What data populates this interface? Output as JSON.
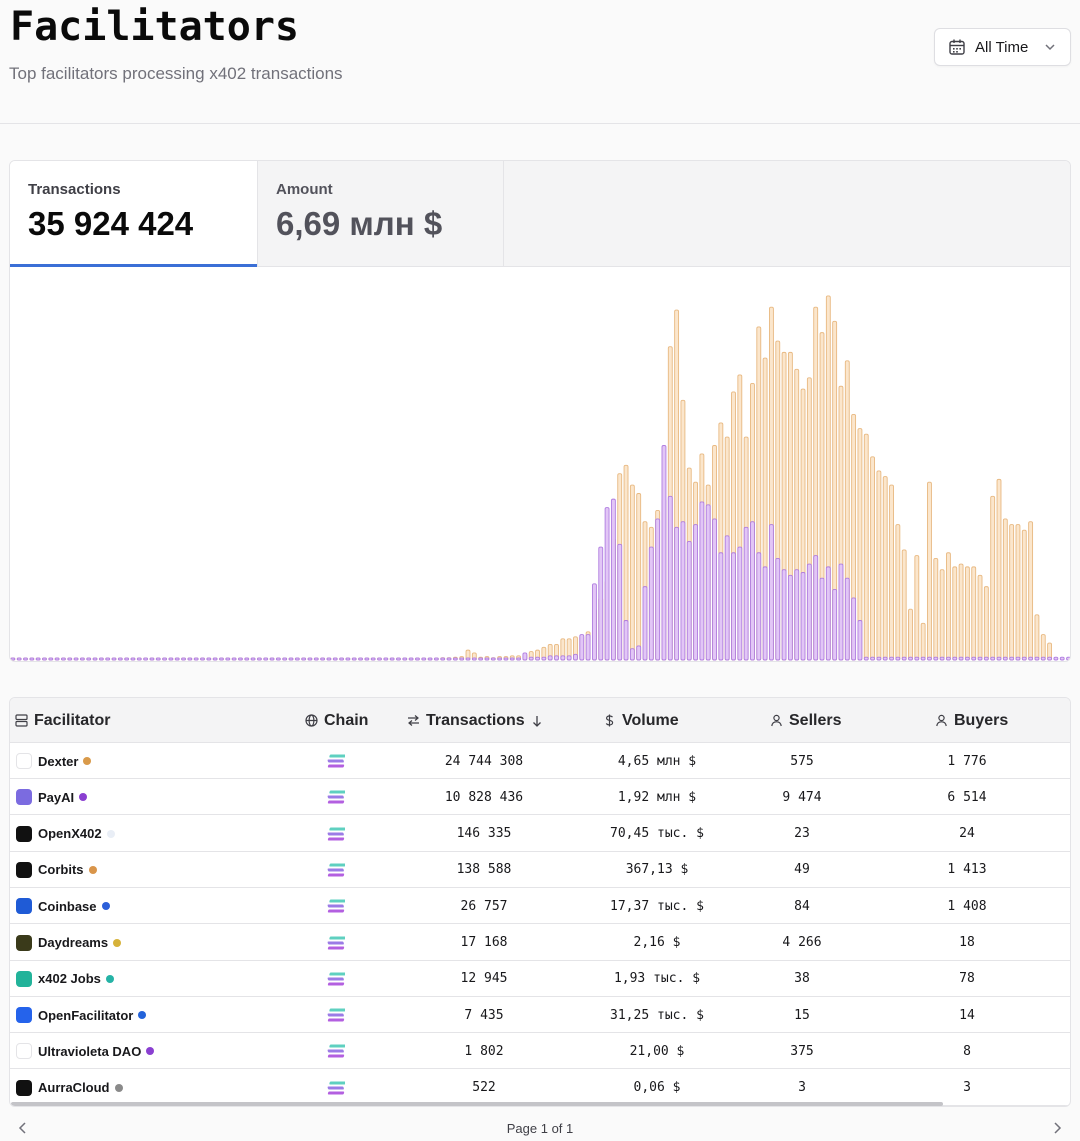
{
  "header": {
    "title": "Facilitators",
    "subtitle": "Top facilitators processing x402 transactions",
    "range_label": "All Time"
  },
  "stats": {
    "transactions_label": "Transactions",
    "transactions_value": "35 924 424",
    "amount_label": "Amount",
    "amount_value": "6,69 млн $"
  },
  "colors": {
    "accent": "#3b6fd6",
    "bar_primary_fill": "#fbe6cc",
    "bar_primary_stroke": "#e8b982",
    "bar_secondary_fill": "#e2c6f6",
    "bar_secondary_stroke": "#b07ee0"
  },
  "chart_data": {
    "type": "bar",
    "stacked": false,
    "series": [
      {
        "values": [
          0.02,
          0.02,
          0.02,
          0.02,
          0.02,
          0.02,
          0.02,
          0.02,
          0.02,
          0.02,
          0.02,
          0.02,
          0.02,
          0.02,
          0.02,
          0.02,
          0.02,
          0.02,
          0.02,
          0.02,
          0.02,
          0.02,
          0.02,
          0.02,
          0.02,
          0.02,
          0.02,
          0.02,
          0.02,
          0.02,
          0.02,
          0.02,
          0.02,
          0.02,
          0.02,
          0.02,
          0.02,
          0.02,
          0.02,
          0.02,
          0.03,
          0.03,
          0.03,
          0.03,
          0.03,
          0.03,
          0.03,
          0.03,
          0.04,
          0.04,
          0.04,
          0.04,
          0.04,
          0.04,
          0.04,
          0.04,
          0.04,
          0.04,
          0.05,
          0.05,
          0.05,
          0.05,
          0.05,
          0.06,
          0.06,
          0.06,
          0.06,
          0.07,
          0.08,
          0.08,
          0.1,
          0.12,
          0.35,
          0.25,
          0.1,
          0.12,
          0.08,
          0.12,
          0.12,
          0.15,
          0.15,
          0.2,
          0.3,
          0.35,
          0.45,
          0.55,
          0.55,
          0.75,
          0.75,
          0.82,
          0.85,
          1.0,
          1.8,
          2.2,
          2.8,
          4.3,
          6.6,
          6.9,
          6.2,
          5.9,
          4.9,
          4.7,
          5.3,
          5.7,
          11.1,
          12.4,
          9.2,
          6.8,
          6.3,
          7.3,
          6.2,
          7.6,
          8.4,
          7.9,
          9.5,
          10.1,
          7.9,
          9.8,
          11.8,
          10.7,
          12.5,
          11.3,
          10.9,
          10.9,
          10.3,
          9.6,
          10.0,
          12.5,
          11.6,
          12.9,
          12.0,
          9.7,
          10.6,
          8.7,
          8.2,
          8.0,
          7.2,
          6.7,
          6.5,
          6.2,
          4.8,
          3.9,
          1.8,
          3.7,
          1.3,
          6.3,
          3.6,
          3.2,
          3.8,
          3.3,
          3.4,
          3.3,
          3.3,
          3.0,
          2.6,
          5.8,
          6.4,
          5.0,
          4.8,
          4.8,
          4.6,
          4.9,
          1.6,
          0.9,
          0.6
        ]
      },
      {
        "values": [
          0.02,
          0.02,
          0.02,
          0.02,
          0.02,
          0.02,
          0.02,
          0.02,
          0.02,
          0.02,
          0.02,
          0.02,
          0.02,
          0.02,
          0.02,
          0.02,
          0.02,
          0.02,
          0.02,
          0.02,
          0.02,
          0.02,
          0.02,
          0.02,
          0.02,
          0.02,
          0.02,
          0.02,
          0.02,
          0.02,
          0.02,
          0.02,
          0.02,
          0.02,
          0.02,
          0.02,
          0.02,
          0.02,
          0.02,
          0.02,
          0.02,
          0.02,
          0.02,
          0.02,
          0.02,
          0.02,
          0.02,
          0.02,
          0.03,
          0.03,
          0.03,
          0.03,
          0.03,
          0.03,
          0.04,
          0.04,
          0.04,
          0.04,
          0.04,
          0.04,
          0.04,
          0.04,
          0.04,
          0.04,
          0.04,
          0.04,
          0.04,
          0.04,
          0.05,
          0.05,
          0.05,
          0.05,
          0.06,
          0.06,
          0.06,
          0.06,
          0.06,
          0.06,
          0.06,
          0.06,
          0.06,
          0.25,
          0.1,
          0.1,
          0.1,
          0.15,
          0.15,
          0.15,
          0.15,
          0.2,
          0.9,
          0.9,
          2.7,
          4.0,
          5.4,
          5.7,
          4.1,
          1.4,
          0.4,
          0.5,
          2.6,
          4.0,
          5.0,
          7.6,
          5.8,
          4.7,
          4.9,
          4.2,
          4.8,
          5.6,
          5.5,
          5.0,
          3.8,
          4.4,
          3.8,
          4.0,
          4.7,
          4.9,
          3.8,
          3.3,
          4.8,
          3.6,
          3.2,
          3.0,
          3.2,
          3.1,
          3.4,
          3.7,
          2.9,
          3.3,
          2.5,
          3.4,
          2.9,
          2.2,
          1.4,
          0.1,
          0.1,
          0.1,
          0.1,
          0.1,
          0.1,
          0.1,
          0.1,
          0.1,
          0.1,
          0.1,
          0.1,
          0.1,
          0.1,
          0.1,
          0.1,
          0.1,
          0.1,
          0.1,
          0.1,
          0.1,
          0.1,
          0.1,
          0.1,
          0.1,
          0.1,
          0.1,
          0.1,
          0.1,
          0.1,
          0.1,
          0.1,
          0.1
        ]
      }
    ],
    "ylim": [
      0,
      13.5
    ],
    "grid": false,
    "legend": "none"
  },
  "table": {
    "columns": {
      "facilitator": "Facilitator",
      "chain": "Chain",
      "transactions": "Transactions",
      "volume": "Volume",
      "sellers": "Sellers",
      "buyers": "Buyers"
    },
    "rows": [
      {
        "name": "Dexter",
        "logo_bg": "#ffffff",
        "logo_icon": "dexter-logo-icon",
        "dot": "#d99a4a",
        "transactions": "24 744 308",
        "volume": "4,65 млн $",
        "sellers": "575",
        "buyers": "1 776"
      },
      {
        "name": "PayAI",
        "logo_bg": "#7b6be0",
        "logo_icon": "payai-logo-icon",
        "dot": "#8a3fd1",
        "transactions": "10 828 436",
        "volume": "1,92 млн $",
        "sellers": "9 474",
        "buyers": "6 514"
      },
      {
        "name": "OpenX402",
        "logo_bg": "#111111",
        "logo_icon": "openx402-logo-icon",
        "dot": "#e9eef6",
        "transactions": "146 335",
        "volume": "70,45 тыс. $",
        "sellers": "23",
        "buyers": "24"
      },
      {
        "name": "Corbits",
        "logo_bg": "#111111",
        "logo_icon": "corbits-logo-icon",
        "dot": "#d9954a",
        "transactions": "138 588",
        "volume": "367,13 $",
        "sellers": "49",
        "buyers": "1 413"
      },
      {
        "name": "Coinbase",
        "logo_bg": "#1f5bd6",
        "logo_icon": "coinbase-logo-icon",
        "dot": "#2c5fd9",
        "transactions": "26 757",
        "volume": "17,37 тыс. $",
        "sellers": "84",
        "buyers": "1 408"
      },
      {
        "name": "Daydreams",
        "logo_bg": "#3a3a1a",
        "logo_icon": "daydreams-logo-icon",
        "dot": "#d6b23a",
        "transactions": "17 168",
        "volume": "2,16 $",
        "sellers": "4 266",
        "buyers": "18"
      },
      {
        "name": "x402 Jobs",
        "logo_bg": "#22b39a",
        "logo_icon": "x402jobs-logo-icon",
        "dot": "#25b3a6",
        "transactions": "12 945",
        "volume": "1,93 тыс. $",
        "sellers": "38",
        "buyers": "78"
      },
      {
        "name": "OpenFacilitator",
        "logo_bg": "#2563eb",
        "logo_icon": "openfacilitator-logo-icon",
        "dot": "#2463da",
        "transactions": "7 435",
        "volume": "31,25 тыс. $",
        "sellers": "15",
        "buyers": "14"
      },
      {
        "name": "Ultravioleta DAO",
        "logo_bg": "#ffffff",
        "logo_icon": "ultravioleta-logo-icon",
        "dot": "#8a3fd1",
        "transactions": "1 802",
        "volume": "21,00 $",
        "sellers": "375",
        "buyers": "8"
      },
      {
        "name": "AurraCloud",
        "logo_bg": "#111111",
        "logo_icon": "aurracloud-logo-icon",
        "dot": "#8a8a8a",
        "transactions": "522",
        "volume": "0,06 $",
        "sellers": "3",
        "buyers": "3"
      }
    ]
  },
  "pagination": {
    "label": "Page 1 of 1"
  }
}
